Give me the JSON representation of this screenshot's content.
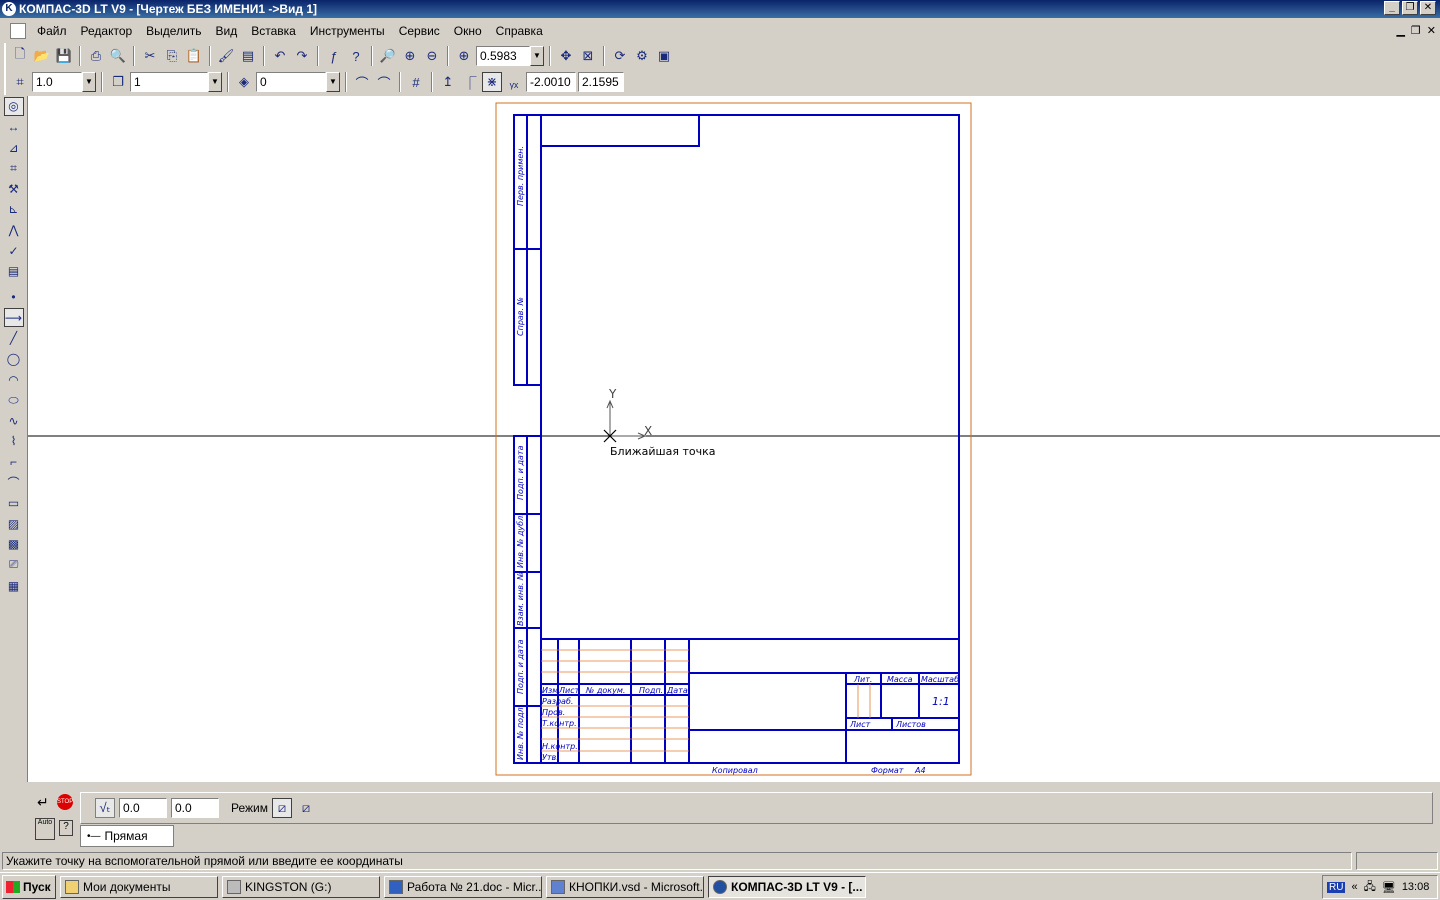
{
  "window": {
    "title": "КОМПАС-3D LT V9 - [Чертеж БЕЗ ИМЕНИ1 ->Вид 1]",
    "controls": [
      "_",
      "❐",
      "✕"
    ]
  },
  "menu": {
    "items": [
      "Файл",
      "Редактор",
      "Выделить",
      "Вид",
      "Вставка",
      "Инструменты",
      "Сервис",
      "Окно",
      "Справка"
    ]
  },
  "toolbar1": {
    "zoom_value": "0.5983"
  },
  "toolbar2": {
    "step_value": "1.0",
    "layer_value": "1",
    "style_value": "0",
    "cursor_x": "-2.0010",
    "cursor_y": "2.1595"
  },
  "canvas": {
    "axis_y_label": "Y",
    "axis_x_label": "X",
    "snap_hint": "Ближайшая точка",
    "stamp": {
      "side_labels": [
        "Перв. примен.",
        "Справ. №",
        "Подп. и дата",
        "Инв. № дубл.",
        "Взам. инв. №",
        "Подп. и дата",
        "Инв. № подл."
      ],
      "change_headers": [
        "Изм",
        "Лист",
        "№ докум.",
        "Подп.",
        "Дата"
      ],
      "role_labels": [
        "Разраб.",
        "Пров.",
        "Т.контр.",
        "Н.контр.",
        "Утв."
      ],
      "lit_label": "Лит.",
      "mass_label": "Масса",
      "scale_label": "Масштаб",
      "scale_value": "1:1",
      "sheet_label": "Лист",
      "sheets_label": "Листов",
      "copied_label": "Копировал",
      "format_label": "Формат",
      "format_value": "A4"
    }
  },
  "props": {
    "x_value": "0.0",
    "y_value": "0.0",
    "mode_label": "Режим",
    "tab_label": "Прямая"
  },
  "status": {
    "text": "Укажите точку на вспомогательной прямой или введите ее координаты"
  },
  "taskbar": {
    "start_label": "Пуск",
    "tasks": [
      "Мои документы",
      "KINGSTON (G:)",
      "Работа № 21.doc - Micr...",
      "КНОПКИ.vsd - Microsoft...",
      "КОМПАС-3D LT V9 - [..."
    ],
    "tray_lang": "RU",
    "clock": "13:08"
  },
  "colors": {
    "title_gradient_start": "#0a246a",
    "frame_blue": "#0000c0",
    "sheet_border_orange": "#d07020",
    "stamp_orange_lines": "#e07a30"
  }
}
